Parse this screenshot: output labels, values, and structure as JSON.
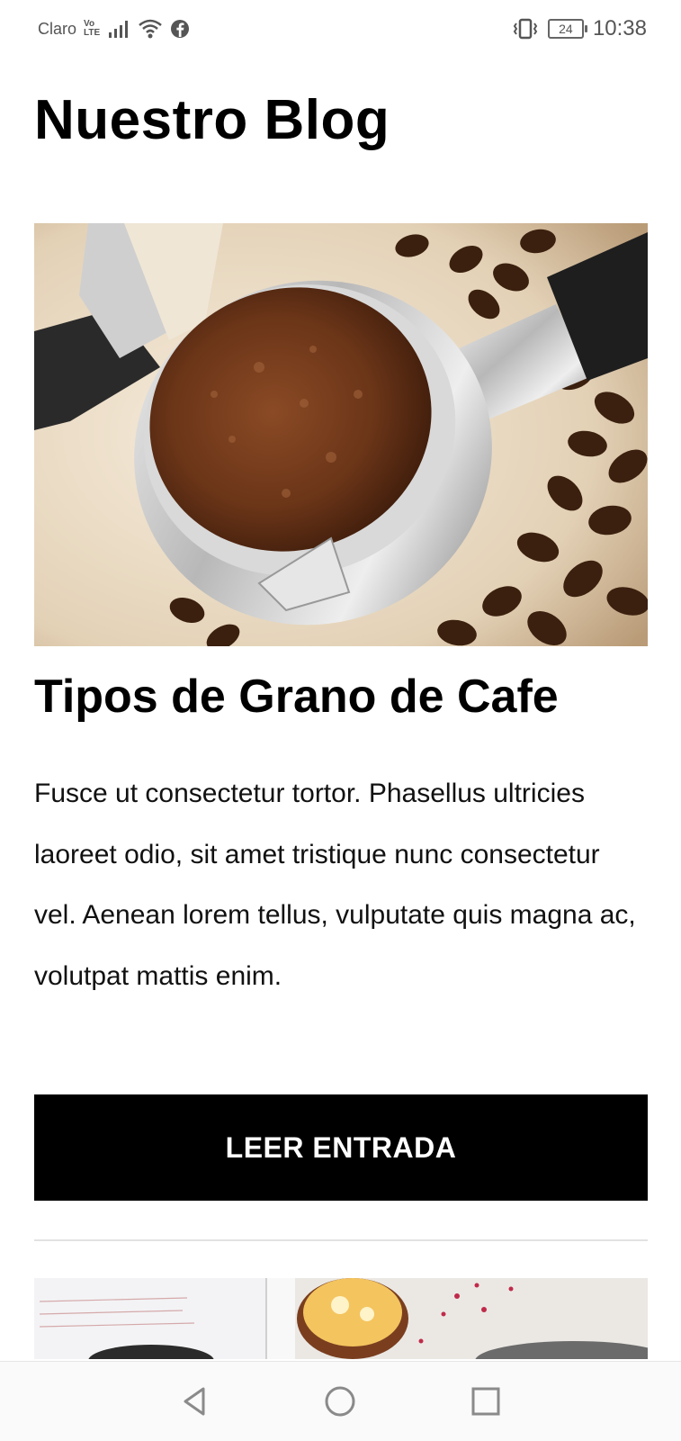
{
  "status_bar": {
    "carrier": "Claro",
    "volte_top": "Vo",
    "volte_bottom": "LTE",
    "battery": "24",
    "time": "10:38"
  },
  "page": {
    "title": "Nuestro Blog"
  },
  "posts": [
    {
      "title": "Tipos de Grano de Cafe",
      "excerpt": "Fusce ut consectetur tortor. Phasellus ultricies laoreet odio, sit amet tristique nunc consectetur vel. Aenean lorem tellus, vulputate quis magna ac, volutpat mattis enim.",
      "button_label": "LEER ENTRADA"
    }
  ],
  "icons": {
    "signal": "signal-icon",
    "wifi": "wifi-icon",
    "facebook": "facebook-icon",
    "vibrate": "vibrate-icon",
    "back": "back-icon",
    "home": "home-icon",
    "recents": "recents-icon"
  }
}
